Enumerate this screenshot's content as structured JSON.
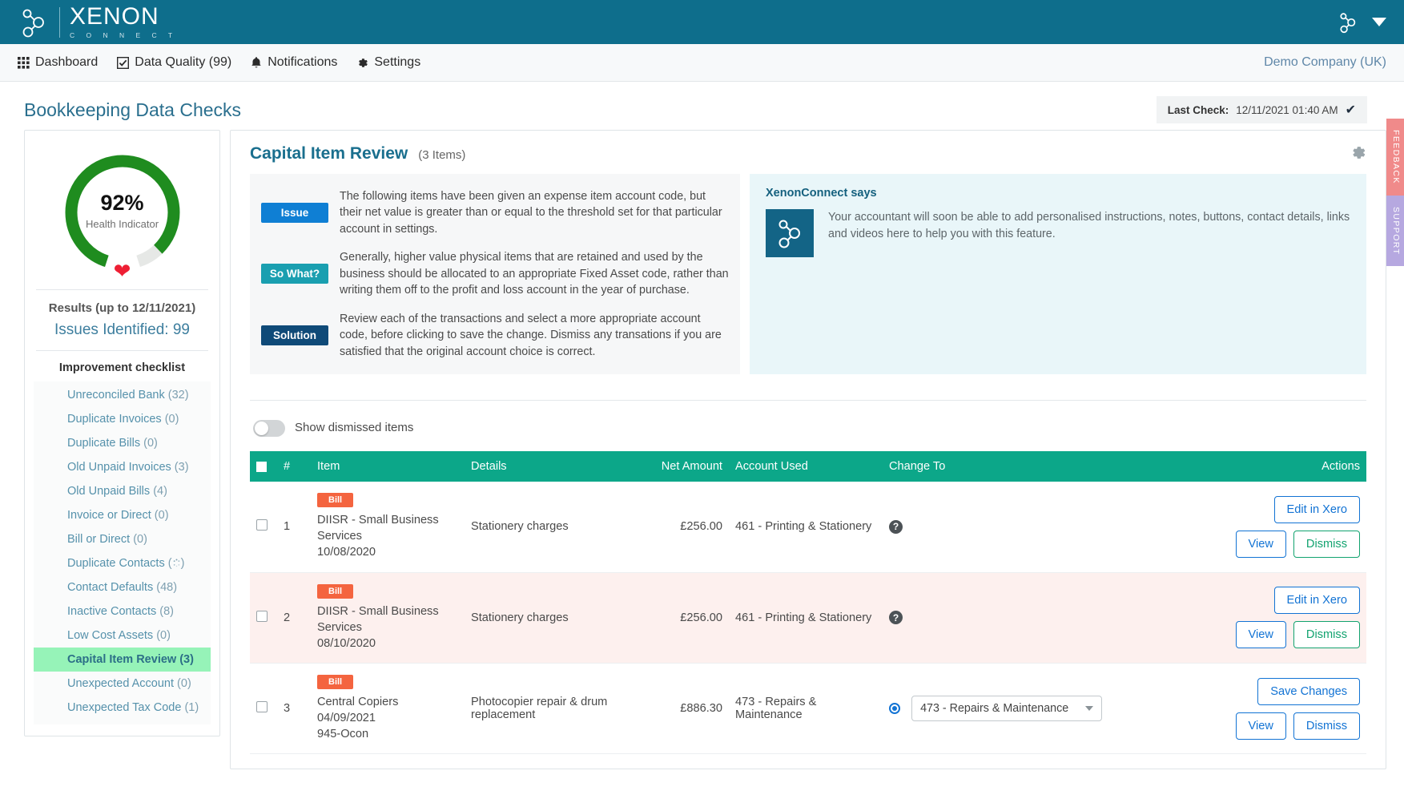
{
  "brand": {
    "name": "XENON",
    "subtitle": "C O N N E C T",
    "logo_icon": "node-graph-icon",
    "account_icon": "node-graph-icon",
    "account_caret": "chevron-down-icon"
  },
  "nav": {
    "items": [
      {
        "label": "Dashboard",
        "icon": "grid-icon"
      },
      {
        "label": "Data Quality (99)",
        "icon": "checkbox-checked-icon"
      },
      {
        "label": "Notifications",
        "icon": "bell-icon"
      },
      {
        "label": "Settings",
        "icon": "gear-icon"
      }
    ],
    "company": "Demo Company (UK)"
  },
  "page": {
    "title": "Bookkeeping Data Checks",
    "last_check_label": "Last Check:",
    "last_check_value": "12/11/2021 01:40 AM",
    "last_check_icon": "check-tick-icon"
  },
  "sidebar": {
    "gauge": {
      "percent_text": "92%",
      "percent_value": 92,
      "label": "Health Indicator",
      "arc_color": "#1f8c1f",
      "track_color": "#e6e8e6",
      "heart_icon": "heart-icon",
      "heart_color": "#ee1f34"
    },
    "results_label": "Results (up to 12/11/2021)",
    "issues_label": "Issues Identified: 99",
    "checklist_title": "Improvement checklist",
    "items": [
      {
        "label": "Unreconciled Bank",
        "count": "(32)",
        "active": false
      },
      {
        "label": "Duplicate Invoices",
        "count": "(0)",
        "active": false
      },
      {
        "label": "Duplicate Bills",
        "count": "(0)",
        "active": false
      },
      {
        "label": "Old Unpaid Invoices",
        "count": "(3)",
        "active": false
      },
      {
        "label": "Old Unpaid Bills",
        "count": "(4)",
        "active": false
      },
      {
        "label": "Invoice or Direct",
        "count": "(0)",
        "active": false
      },
      {
        "label": "Bill or Direct",
        "count": "(0)",
        "active": false
      },
      {
        "label": "Duplicate Contacts",
        "count": "",
        "spinner": true,
        "active": false
      },
      {
        "label": "Contact Defaults",
        "count": "(48)",
        "active": false
      },
      {
        "label": "Inactive Contacts",
        "count": "(8)",
        "active": false
      },
      {
        "label": "Low Cost Assets",
        "count": "(0)",
        "active": false
      },
      {
        "label": "Capital Item Review",
        "count": "(3)",
        "active": true
      },
      {
        "label": "Unexpected Account",
        "count": "(0)",
        "active": false
      },
      {
        "label": "Unexpected Tax Code",
        "count": "(1)",
        "active": false
      }
    ]
  },
  "panel": {
    "title": "Capital Item Review",
    "count": "(3 Items)",
    "gear_icon": "gear-icon",
    "explain": [
      {
        "badge": "Issue",
        "badge_color": "#0f7fd4",
        "text": "The following items have been given an expense item account code, but their net value is greater than or equal to the threshold set for that particular account in settings."
      },
      {
        "badge": "So What?",
        "badge_color": "#1a9fb0",
        "text": "Generally, higher value physical items that are retained and used by the business should be allocated to an appropriate Fixed Asset code, rather than writing them off to the profit and loss account in the year of purchase."
      },
      {
        "badge": "Solution",
        "badge_color": "#0f4a78",
        "text": "Review each of the transactions and select a more appropriate account code, before clicking to save the change. Dismiss any transations if you are satisfied that the original account choice is correct."
      }
    ],
    "says": {
      "title": "XenonConnect says",
      "logo_icon": "node-graph-icon",
      "text": "Your accountant will soon be able to add personalised instructions, notes, buttons, contact details, links and videos here to help you with this feature."
    },
    "toggle": {
      "label": "Show dismissed items",
      "state": "off"
    },
    "table": {
      "columns": [
        "",
        "#",
        "Item",
        "Details",
        "Net Amount",
        "Account Used",
        "Change To",
        "Actions"
      ],
      "select_all_icon": "checkbox-icon",
      "rows": [
        {
          "index": "1",
          "pill": "Bill",
          "item_name": "DIISR - Small Business Services",
          "item_date": "10/08/2020",
          "item_ref": "",
          "details": "Stationery charges",
          "net_amount": "£256.00",
          "account_used": "461 - Printing & Stationery",
          "change_to_kind": "help",
          "change_to_icon": "question-mark-icon",
          "change_to_value": "",
          "actions": [
            "Edit in Xero",
            "View",
            "Dismiss"
          ],
          "primary_action": "Edit in Xero",
          "alt": false
        },
        {
          "index": "2",
          "pill": "Bill",
          "item_name": "DIISR - Small Business Services",
          "item_date": "08/10/2020",
          "item_ref": "",
          "details": "Stationery charges",
          "net_amount": "£256.00",
          "account_used": "461 - Printing & Stationery",
          "change_to_kind": "help",
          "change_to_icon": "question-mark-icon",
          "change_to_value": "",
          "actions": [
            "Edit in Xero",
            "View",
            "Dismiss"
          ],
          "primary_action": "Edit in Xero",
          "alt": true
        },
        {
          "index": "3",
          "pill": "Bill",
          "item_name": "Central Copiers",
          "item_date": "04/09/2021",
          "item_ref": "945-Ocon",
          "details": "Photocopier repair & drum replacement",
          "net_amount": "£886.30",
          "account_used": "473 - Repairs & Maintenance",
          "change_to_kind": "select",
          "change_to_icon": "radio-selected-icon",
          "change_to_value": "473 - Repairs & Maintenance",
          "actions": [
            "Save Changes",
            "View",
            "Dismiss"
          ],
          "primary_action": "Save Changes",
          "alt": false
        }
      ]
    }
  },
  "edge_tabs": [
    {
      "label": "FEEDBACK",
      "color": "#f08a8a"
    },
    {
      "label": "SUPPORT",
      "color": "#b6a8e0"
    }
  ]
}
